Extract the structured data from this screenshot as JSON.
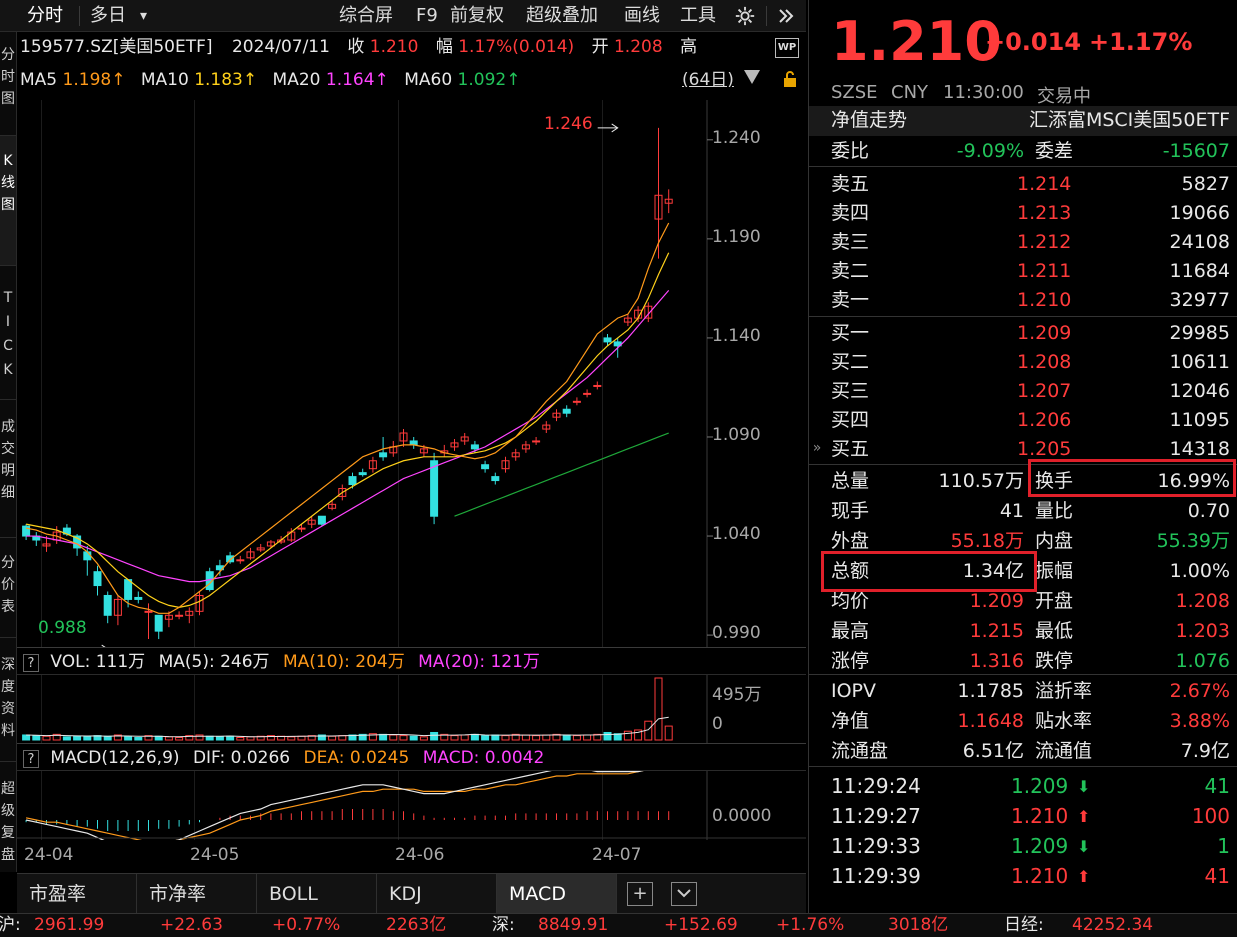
{
  "toolbar": {
    "items": [
      "分时",
      "多日",
      "▾",
      "综合屏",
      "F9",
      "前复权",
      "超级叠加",
      "画线",
      "工具"
    ],
    "gear_icon": "gear-icon",
    "expand_icon": "double-chevron-right-icon"
  },
  "sidebar": [
    "分\n时\n图",
    "K\n线\n图",
    "T\nI\nC\nK",
    "成\n交\n明\n细",
    "分\n价\n表",
    "深\n度\n资\n料",
    "超\n级\n复\n盘"
  ],
  "info": {
    "code": "159577.SZ[美国50ETF]",
    "date": "2024/07/11",
    "close_label": "收",
    "close": "1.210",
    "change_label": "幅",
    "change": "1.17%(0.014)",
    "open_label": "开",
    "open": "1.208",
    "high_label": "高",
    "ma5_label": "MA5",
    "ma5": "1.198↑",
    "ma10_label": "MA10",
    "ma10": "1.183↑",
    "ma20_label": "MA20",
    "ma20": "1.164↑",
    "ma60_label": "MA60",
    "ma60": "1.092↑",
    "days": "(64日)"
  },
  "price_axis": [
    "1.240",
    "1.190",
    "1.140",
    "1.090",
    "1.040",
    "0.990"
  ],
  "annotations": {
    "high": "1.246",
    "low": "0.988"
  },
  "vol_head": {
    "label": "VOL: 111万",
    "ma5": "MA(5): 246万",
    "ma10": "MA(10): 204万",
    "ma20": "MA(20): 121万",
    "axis_top": "495万",
    "axis_zero": "0"
  },
  "macd_head": {
    "label": "MACD(12,26,9)",
    "dif": "DIF: 0.0266",
    "dea": "DEA: 0.0245",
    "macd": "MACD: 0.0042",
    "axis_zero": "0.0000"
  },
  "x_axis": [
    "24-04",
    "24-05",
    "24-06",
    "24-07"
  ],
  "tabs": [
    "市盈率",
    "市净率",
    "BOLL",
    "KDJ",
    "MACD"
  ],
  "statusbar": {
    "sh_label": "沪:",
    "sh": "2961.99",
    "sh_chg": "+22.63",
    "sh_pct": "+0.77%",
    "sh_amt": "2263亿",
    "sz_label": "深:",
    "sz": "8849.91",
    "sz_chg": "+152.69",
    "sz_pct": "+1.76%",
    "sz_amt": "3018亿",
    "nk_label": "日经:",
    "nk": "42252.34"
  },
  "quote": {
    "price": "1.210",
    "change": "+0.014",
    "pct": "+1.17%",
    "exchange": "SZSE",
    "currency": "CNY",
    "time": "11:30:00",
    "status": "交易中",
    "nav_trend": "净值走势",
    "name": "汇添富MSCI美国50ETF",
    "wb_label": "委比",
    "wb": "-9.09%",
    "wc_label": "委差",
    "wc": "-15607"
  },
  "asks": [
    {
      "label": "卖五",
      "price": "1.214",
      "vol": "5827"
    },
    {
      "label": "卖四",
      "price": "1.213",
      "vol": "19066"
    },
    {
      "label": "卖三",
      "price": "1.212",
      "vol": "24108"
    },
    {
      "label": "卖二",
      "price": "1.211",
      "vol": "11684"
    },
    {
      "label": "卖一",
      "price": "1.210",
      "vol": "32977"
    }
  ],
  "bids": [
    {
      "label": "买一",
      "price": "1.209",
      "vol": "29985"
    },
    {
      "label": "买二",
      "price": "1.208",
      "vol": "10611"
    },
    {
      "label": "买三",
      "price": "1.207",
      "vol": "12046"
    },
    {
      "label": "买四",
      "price": "1.206",
      "vol": "11095"
    },
    {
      "label": "买五",
      "price": "1.205",
      "vol": "14318"
    }
  ],
  "stats": [
    [
      {
        "l": "总量",
        "v": "110.57万",
        "c": "white"
      },
      {
        "l": "换手",
        "v": "16.99%",
        "c": "white"
      }
    ],
    [
      {
        "l": "现手",
        "v": "41",
        "c": "white"
      },
      {
        "l": "量比",
        "v": "0.70",
        "c": "white"
      }
    ],
    [
      {
        "l": "外盘",
        "v": "55.18万",
        "c": "red"
      },
      {
        "l": "内盘",
        "v": "55.39万",
        "c": "green"
      }
    ],
    [
      {
        "l": "总额",
        "v": "1.34亿",
        "c": "white"
      },
      {
        "l": "振幅",
        "v": "1.00%",
        "c": "white"
      }
    ],
    [
      {
        "l": "均价",
        "v": "1.209",
        "c": "red"
      },
      {
        "l": "开盘",
        "v": "1.208",
        "c": "red"
      }
    ],
    [
      {
        "l": "最高",
        "v": "1.215",
        "c": "red"
      },
      {
        "l": "最低",
        "v": "1.203",
        "c": "red"
      }
    ],
    [
      {
        "l": "涨停",
        "v": "1.316",
        "c": "red"
      },
      {
        "l": "跌停",
        "v": "1.076",
        "c": "green"
      }
    ]
  ],
  "nav": [
    [
      {
        "l": "IOPV",
        "v": "1.1785",
        "c": "white"
      },
      {
        "l": "溢折率",
        "v": "2.67%",
        "c": "red"
      }
    ],
    [
      {
        "l": "净值",
        "v": "1.1648",
        "c": "red"
      },
      {
        "l": "贴水率",
        "v": "3.88%",
        "c": "red"
      }
    ],
    [
      {
        "l": "流通盘",
        "v": "6.51亿",
        "c": "white"
      },
      {
        "l": "流通值",
        "v": "7.9亿",
        "c": "white"
      }
    ]
  ],
  "ticks": [
    {
      "t": "11:29:24",
      "p": "1.209",
      "d": "down",
      "v": "41"
    },
    {
      "t": "11:29:27",
      "p": "1.210",
      "d": "up",
      "v": "100"
    },
    {
      "t": "11:29:33",
      "p": "1.209",
      "d": "down",
      "v": "1"
    },
    {
      "t": "11:29:39",
      "p": "1.210",
      "d": "up",
      "v": "41"
    }
  ],
  "chart_data": {
    "type": "candlestick",
    "price_range": [
      0.985,
      1.25
    ],
    "candles": [
      [
        1.045,
        1.046,
        1.04,
        1.038
      ],
      [
        1.04,
        1.042,
        1.038,
        1.035
      ],
      [
        1.035,
        1.04,
        1.036,
        1.032
      ],
      [
        1.038,
        1.045,
        1.042,
        1.036
      ],
      [
        1.044,
        1.046,
        1.041,
        1.04
      ],
      [
        1.04,
        1.041,
        1.034,
        1.03
      ],
      [
        1.032,
        1.035,
        1.028,
        1.02
      ],
      [
        1.022,
        1.025,
        1.015,
        1.01
      ],
      [
        1.01,
        1.012,
        1.0,
        0.996
      ],
      [
        1.0,
        1.01,
        1.008,
        0.995
      ],
      [
        1.018,
        1.018,
        1.008,
        1.004
      ],
      [
        1.009,
        1.012,
        1.008,
        1.006
      ],
      [
        1.002,
        1.006,
        1.002,
        0.988
      ],
      [
        1.0,
        1.0,
        0.992,
        0.988
      ],
      [
        0.998,
        1.002,
        1.0,
        0.994
      ],
      [
        1.0,
        1.002,
        1.0,
        0.998
      ],
      [
        1.0,
        1.004,
        1.002,
        0.996
      ],
      [
        1.002,
        1.012,
        1.01,
        1.0
      ],
      [
        1.022,
        1.024,
        1.013,
        1.012
      ],
      [
        1.025,
        1.028,
        1.023,
        1.02
      ],
      [
        1.03,
        1.032,
        1.027,
        1.026
      ],
      [
        1.028,
        1.03,
        1.028,
        1.026
      ],
      [
        1.029,
        1.034,
        1.032,
        1.028
      ],
      [
        1.033,
        1.036,
        1.034,
        1.032
      ],
      [
        1.035,
        1.038,
        1.037,
        1.034
      ],
      [
        1.037,
        1.04,
        1.038,
        1.036
      ],
      [
        1.038,
        1.044,
        1.042,
        1.037
      ],
      [
        1.044,
        1.046,
        1.044,
        1.042
      ],
      [
        1.046,
        1.05,
        1.048,
        1.044
      ],
      [
        1.05,
        1.05,
        1.046,
        1.045
      ],
      [
        1.054,
        1.058,
        1.056,
        1.053
      ],
      [
        1.06,
        1.066,
        1.064,
        1.058
      ],
      [
        1.07,
        1.072,
        1.066,
        1.064
      ],
      [
        1.072,
        1.074,
        1.071,
        1.07
      ],
      [
        1.074,
        1.08,
        1.078,
        1.072
      ],
      [
        1.082,
        1.09,
        1.08,
        1.078
      ],
      [
        1.082,
        1.088,
        1.085,
        1.08
      ],
      [
        1.088,
        1.094,
        1.092,
        1.085
      ],
      [
        1.088,
        1.09,
        1.086,
        1.084
      ],
      [
        1.082,
        1.086,
        1.084,
        1.08
      ],
      [
        1.078,
        1.082,
        1.05,
        1.046
      ],
      [
        1.082,
        1.086,
        1.083,
        1.08
      ],
      [
        1.085,
        1.089,
        1.087,
        1.083
      ],
      [
        1.088,
        1.092,
        1.09,
        1.086
      ],
      [
        1.086,
        1.088,
        1.084,
        1.082
      ],
      [
        1.076,
        1.078,
        1.074,
        1.072
      ],
      [
        1.07,
        1.072,
        1.068,
        1.066
      ],
      [
        1.074,
        1.08,
        1.078,
        1.072
      ],
      [
        1.08,
        1.084,
        1.082,
        1.078
      ],
      [
        1.084,
        1.088,
        1.086,
        1.082
      ],
      [
        1.088,
        1.09,
        1.088,
        1.086
      ],
      [
        1.094,
        1.098,
        1.096,
        1.092
      ],
      [
        1.1,
        1.104,
        1.102,
        1.098
      ],
      [
        1.104,
        1.106,
        1.102,
        1.1
      ],
      [
        1.108,
        1.11,
        1.108,
        1.106
      ],
      [
        1.112,
        1.114,
        1.112,
        1.11
      ],
      [
        1.116,
        1.118,
        1.116,
        1.114
      ],
      [
        1.14,
        1.142,
        1.138,
        1.136
      ],
      [
        1.138,
        1.14,
        1.136,
        1.13
      ],
      [
        1.148,
        1.152,
        1.15,
        1.146
      ],
      [
        1.15,
        1.156,
        1.154,
        1.148
      ],
      [
        1.15,
        1.158,
        1.156,
        1.148
      ],
      [
        1.2,
        1.246,
        1.212,
        1.18
      ],
      [
        1.208,
        1.215,
        1.21,
        1.203
      ]
    ],
    "ma5": [
      1.044,
      1.043,
      1.041,
      1.04,
      1.038,
      1.036,
      1.032,
      1.026,
      1.018,
      1.01,
      1.006,
      1.004,
      1.003,
      1.001,
      1.001,
      1.004,
      1.008,
      1.012,
      1.016,
      1.022,
      1.028,
      1.032,
      1.036,
      1.04,
      1.044,
      1.048,
      1.052,
      1.056,
      1.06,
      1.064,
      1.068,
      1.072,
      1.076,
      1.08,
      1.082,
      1.084,
      1.085,
      1.086,
      1.086,
      1.085,
      1.084,
      1.082,
      1.081,
      1.08,
      1.079,
      1.08,
      1.082,
      1.086,
      1.09,
      1.096,
      1.102,
      1.108,
      1.113,
      1.118,
      1.126,
      1.134,
      1.142,
      1.146,
      1.15,
      1.152,
      1.16,
      1.175,
      1.188,
      1.198
    ],
    "ma10": [
      1.046,
      1.045,
      1.044,
      1.043,
      1.041,
      1.039,
      1.036,
      1.032,
      1.027,
      1.022,
      1.018,
      1.014,
      1.01,
      1.007,
      1.005,
      1.004,
      1.005,
      1.007,
      1.01,
      1.014,
      1.018,
      1.022,
      1.026,
      1.03,
      1.034,
      1.038,
      1.042,
      1.046,
      1.05,
      1.054,
      1.058,
      1.062,
      1.065,
      1.068,
      1.071,
      1.074,
      1.076,
      1.078,
      1.079,
      1.08,
      1.08,
      1.08,
      1.08,
      1.081,
      1.082,
      1.083,
      1.085,
      1.087,
      1.09,
      1.094,
      1.098,
      1.103,
      1.108,
      1.113,
      1.119,
      1.125,
      1.131,
      1.136,
      1.14,
      1.144,
      1.15,
      1.16,
      1.172,
      1.183
    ],
    "ma20": [
      1.04,
      1.04,
      1.039,
      1.038,
      1.037,
      1.036,
      1.034,
      1.032,
      1.03,
      1.028,
      1.026,
      1.024,
      1.022,
      1.02,
      1.019,
      1.018,
      1.017,
      1.017,
      1.018,
      1.019,
      1.02,
      1.022,
      1.024,
      1.027,
      1.03,
      1.033,
      1.036,
      1.039,
      1.042,
      1.045,
      1.048,
      1.051,
      1.054,
      1.057,
      1.06,
      1.063,
      1.066,
      1.069,
      1.071,
      1.073,
      1.075,
      1.077,
      1.079,
      1.081,
      1.083,
      1.085,
      1.088,
      1.091,
      1.094,
      1.097,
      1.1,
      1.104,
      1.108,
      1.112,
      1.116,
      1.12,
      1.125,
      1.13,
      1.135,
      1.14,
      1.146,
      1.152,
      1.158,
      1.164
    ],
    "ma60": [
      null,
      null,
      null,
      null,
      null,
      null,
      null,
      null,
      null,
      null,
      null,
      null,
      null,
      null,
      null,
      null,
      null,
      null,
      null,
      null,
      null,
      null,
      null,
      null,
      null,
      null,
      null,
      null,
      null,
      null,
      null,
      null,
      null,
      null,
      null,
      null,
      null,
      null,
      null,
      null,
      null,
      null,
      1.05,
      1.052,
      1.054,
      1.056,
      1.058,
      1.06,
      1.062,
      1.064,
      1.066,
      1.068,
      1.07,
      1.072,
      1.074,
      1.076,
      1.078,
      1.08,
      1.082,
      1.084,
      1.086,
      1.088,
      1.09,
      1.092
    ],
    "volume": [
      40,
      35,
      30,
      45,
      25,
      30,
      28,
      35,
      30,
      40,
      25,
      20,
      35,
      30,
      25,
      20,
      35,
      40,
      30,
      25,
      30,
      20,
      25,
      30,
      35,
      30,
      25,
      30,
      35,
      40,
      30,
      35,
      40,
      45,
      50,
      45,
      40,
      35,
      30,
      25,
      60,
      45,
      35,
      40,
      45,
      35,
      40,
      35,
      45,
      40,
      35,
      40,
      45,
      40,
      35,
      40,
      45,
      60,
      50,
      70,
      80,
      150,
      495,
      111
    ],
    "macd_hist": [
      -0.001,
      -0.001,
      -0.002,
      -0.002,
      -0.002,
      -0.003,
      -0.003,
      -0.004,
      -0.005,
      -0.005,
      -0.005,
      -0.005,
      -0.005,
      -0.004,
      -0.004,
      -0.003,
      -0.002,
      -0.001,
      0.0,
      0.001,
      0.002,
      0.002,
      0.002,
      0.003,
      0.003,
      0.003,
      0.003,
      0.004,
      0.004,
      0.004,
      0.004,
      0.005,
      0.005,
      0.005,
      0.005,
      0.005,
      0.004,
      0.004,
      0.003,
      0.002,
      0.001,
      0.001,
      0.001,
      0.001,
      0.002,
      0.002,
      0.002,
      0.002,
      0.003,
      0.003,
      0.003,
      0.003,
      0.003,
      0.003,
      0.003,
      0.004,
      0.004,
      0.004,
      0.004,
      0.004,
      0.004,
      0.004,
      0.004,
      0.004
    ],
    "dif": [
      0.0,
      -0.001,
      -0.002,
      -0.003,
      -0.004,
      -0.005,
      -0.006,
      -0.008,
      -0.01,
      -0.011,
      -0.012,
      -0.012,
      -0.012,
      -0.011,
      -0.01,
      -0.009,
      -0.007,
      -0.005,
      -0.003,
      -0.001,
      0.001,
      0.003,
      0.004,
      0.005,
      0.007,
      0.008,
      0.009,
      0.01,
      0.011,
      0.012,
      0.013,
      0.014,
      0.015,
      0.016,
      0.016,
      0.016,
      0.015,
      0.014,
      0.013,
      0.012,
      0.012,
      0.012,
      0.013,
      0.014,
      0.015,
      0.016,
      0.017,
      0.018,
      0.019,
      0.02,
      0.021,
      0.022,
      0.023,
      0.023,
      0.023,
      0.023,
      0.022,
      0.022,
      0.022,
      0.022,
      0.022,
      0.023,
      0.025,
      0.0266
    ],
    "dea": [
      0.001,
      0.0,
      -0.001,
      -0.001,
      -0.002,
      -0.003,
      -0.004,
      -0.005,
      -0.006,
      -0.007,
      -0.008,
      -0.009,
      -0.01,
      -0.01,
      -0.01,
      -0.009,
      -0.008,
      -0.007,
      -0.006,
      -0.004,
      -0.002,
      0.0,
      0.001,
      0.002,
      0.004,
      0.005,
      0.006,
      0.007,
      0.008,
      0.009,
      0.01,
      0.011,
      0.012,
      0.013,
      0.013,
      0.014,
      0.014,
      0.014,
      0.014,
      0.013,
      0.013,
      0.013,
      0.013,
      0.013,
      0.014,
      0.014,
      0.015,
      0.016,
      0.016,
      0.017,
      0.018,
      0.019,
      0.02,
      0.02,
      0.021,
      0.021,
      0.021,
      0.021,
      0.021,
      0.021,
      0.022,
      0.023,
      0.024,
      0.0245
    ]
  }
}
